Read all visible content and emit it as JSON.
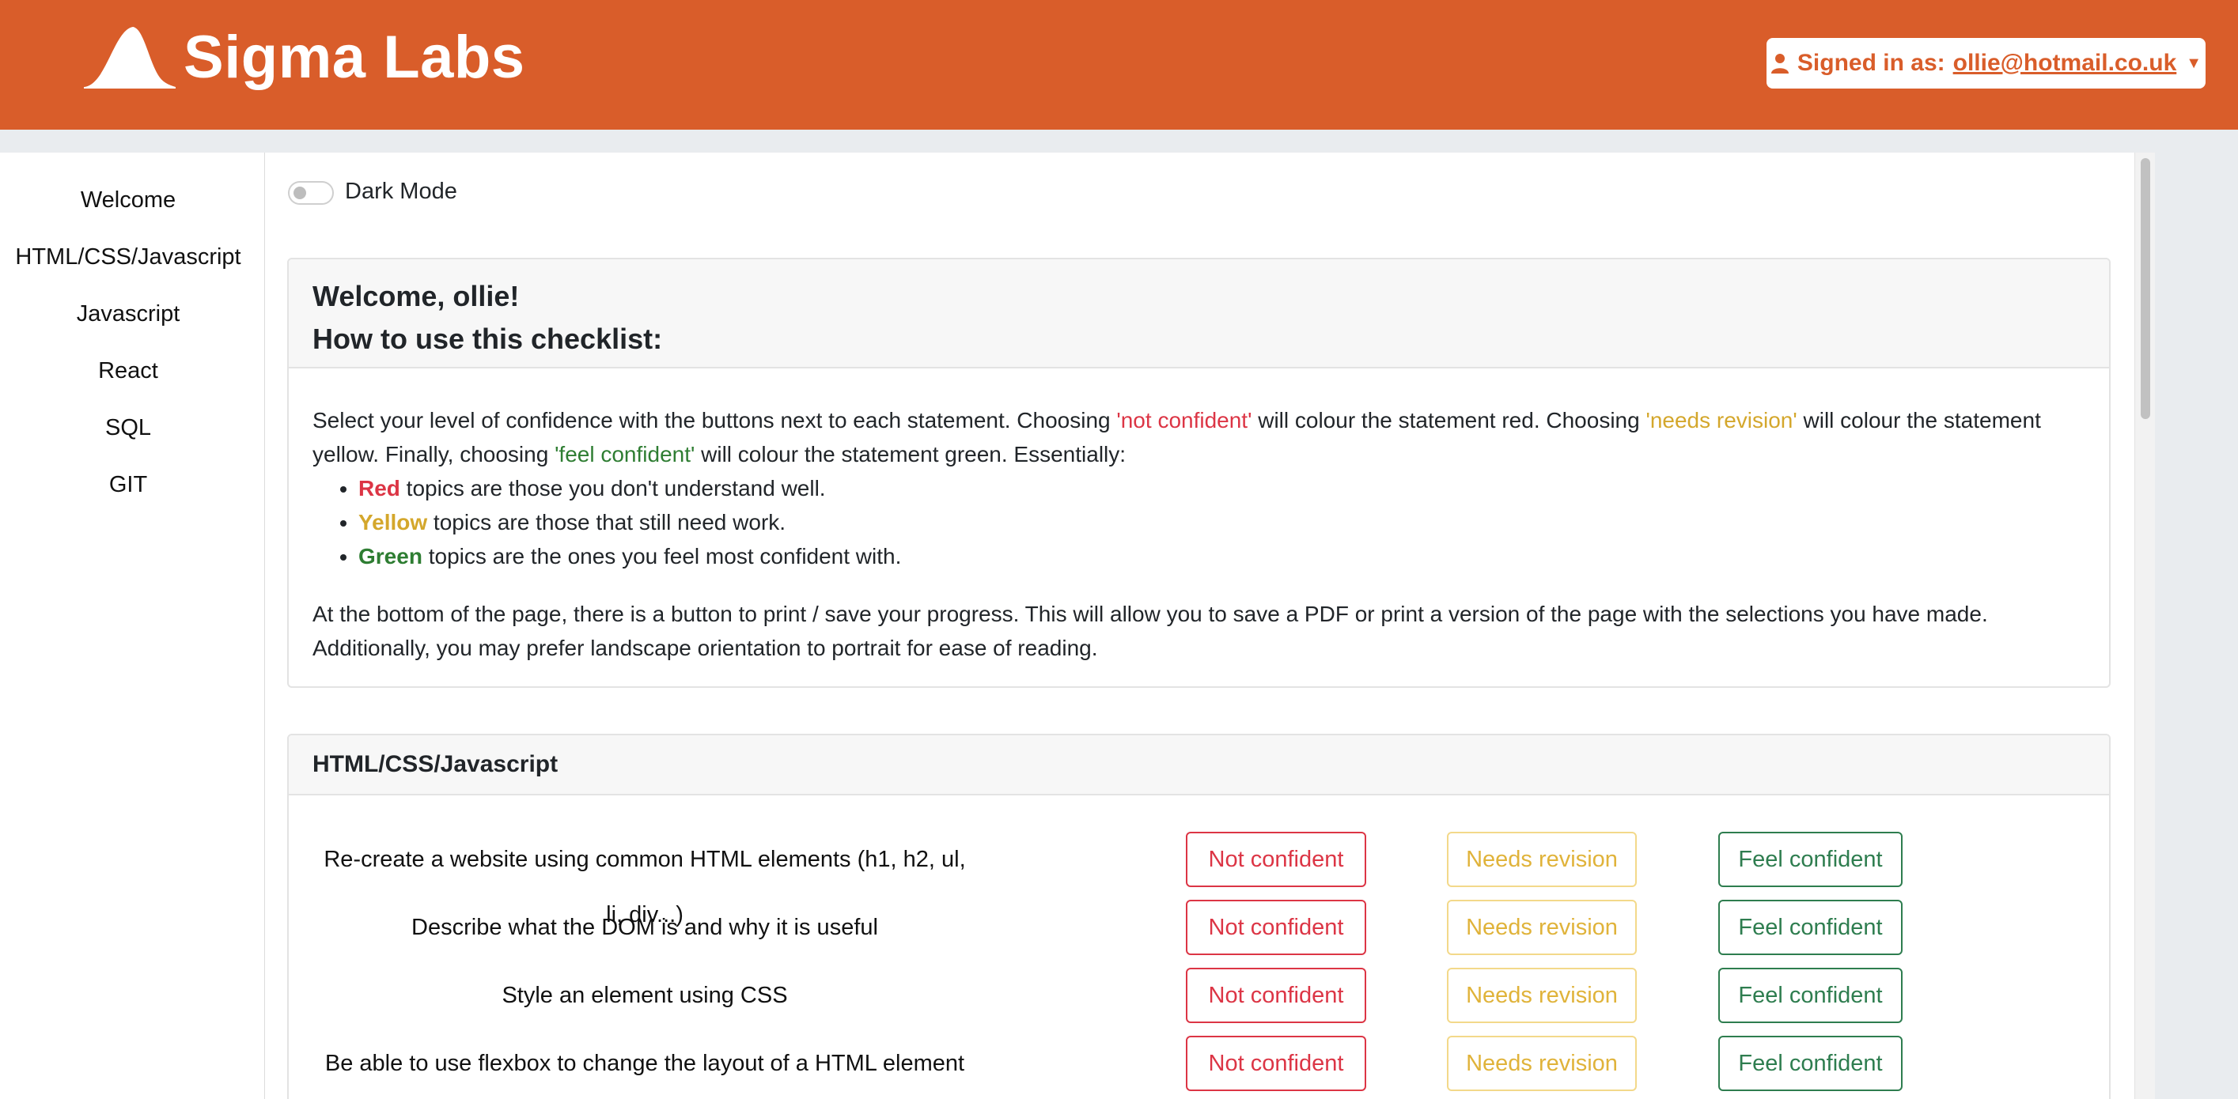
{
  "header": {
    "brand": "Sigma Labs",
    "signed_in_label": "Signed in as:",
    "email": "ollie@hotmail.co.uk"
  },
  "sidebar": {
    "items": [
      {
        "label": "Welcome"
      },
      {
        "label": "HTML/CSS/Javascript"
      },
      {
        "label": "Javascript"
      },
      {
        "label": "React"
      },
      {
        "label": "SQL"
      },
      {
        "label": "GIT"
      }
    ]
  },
  "dark_mode": {
    "label": "Dark Mode",
    "enabled": false
  },
  "intro": {
    "title_line1": "Welcome, ollie!",
    "title_line2": "How to use this checklist:",
    "p1_a": "Select your level of confidence with the buttons next to each statement. Choosing ",
    "p1_not": "'not confident'",
    "p1_b": " will colour the statement red. Choosing ",
    "p1_needs": "'needs revision'",
    "p1_c": " will colour the statement yellow. Finally, choosing ",
    "p1_feel": "'feel confident'",
    "p1_d": " will colour the statement green. Essentially:",
    "bullets": [
      {
        "key": "Red",
        "text": " topics are those you don't understand well."
      },
      {
        "key": "Yellow",
        "text": " topics are those that still need work."
      },
      {
        "key": "Green",
        "text": " topics are the ones you feel most confident with."
      }
    ],
    "p2": "At the bottom of the page, there is a button to print / save your progress. This will allow you to save a PDF or print a version of the page with the selections you have made. Additionally, you may prefer landscape orientation to portrait for ease of reading."
  },
  "section": {
    "title": "HTML/CSS/Javascript",
    "button_labels": {
      "not_confident": "Not confident",
      "needs_revision": "Needs revision",
      "feel_confident": "Feel confident"
    },
    "statements": [
      {
        "text": "Re-create a website using common HTML elements (h1, h2, ul, li, div...)"
      },
      {
        "text": "Describe what the DOM is and why it is useful"
      },
      {
        "text": "Style an element using CSS"
      },
      {
        "text": "Be able to use flexbox to change the layout of a HTML element"
      }
    ]
  },
  "colors": {
    "brand": "#d95d2a",
    "red": "#dc3545",
    "yellow": "#d4a72c",
    "green": "#2e7d32"
  }
}
